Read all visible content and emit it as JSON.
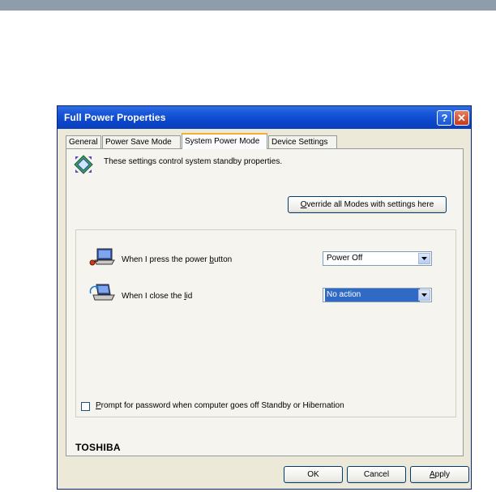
{
  "window": {
    "title": "Full Power Properties",
    "help_label": "?",
    "close_label": "✕"
  },
  "tabs": [
    {
      "label": "General",
      "active": false
    },
    {
      "label": "Power Save Mode",
      "active": false
    },
    {
      "label": "System Power Mode",
      "active": true
    },
    {
      "label": "Device Settings",
      "active": false
    }
  ],
  "panel": {
    "header_text": "These settings control system standby properties.",
    "override_button": {
      "accel": "O",
      "rest": "verride all Modes with settings here"
    },
    "power_button": {
      "label_pre": "When I press the power ",
      "label_accel": "b",
      "label_post": "utton",
      "value": "Power Off",
      "icon": "laptop-power-icon"
    },
    "lid": {
      "label_pre": "When I close the ",
      "label_accel": "l",
      "label_post": "id",
      "value": "No action",
      "icon": "laptop-lid-icon"
    },
    "prompt": {
      "accel": "P",
      "rest": "rompt for password when computer goes off Standby or Hibernation",
      "checked": false
    }
  },
  "brand": "TOSHIBA",
  "buttons": {
    "ok": "OK",
    "cancel": "Cancel",
    "apply_accel": "A",
    "apply_rest": "pply"
  },
  "colors": {
    "titlebar": "#0b45c9",
    "face": "#ece9d8",
    "selection": "#316ac5",
    "tab_highlight": "#f0b034"
  }
}
